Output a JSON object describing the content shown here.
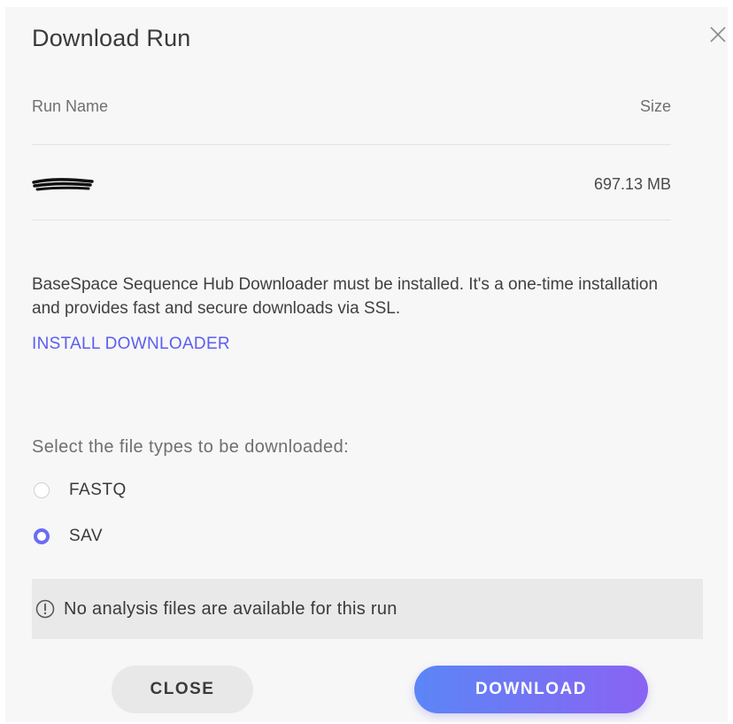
{
  "dialog": {
    "title": "Download Run",
    "close_icon": "close-icon"
  },
  "table": {
    "headers": {
      "name": "Run Name",
      "size": "Size"
    },
    "rows": [
      {
        "name_redacted": true,
        "size": "697.13 MB"
      }
    ]
  },
  "info": {
    "text": "BaseSpace Sequence Hub Downloader must be installed. It's a one-time installation and provides fast and secure downloads via SSL.",
    "install_link": "INSTALL DOWNLOADER"
  },
  "file_types": {
    "label": "Select the file types to be downloaded:",
    "options": [
      {
        "label": "FASTQ",
        "selected": false
      },
      {
        "label": "SAV",
        "selected": true
      }
    ]
  },
  "notice": {
    "icon": "info-circle-icon",
    "text": "No analysis files are available for this run"
  },
  "buttons": {
    "close": "CLOSE",
    "download": "DOWNLOAD"
  },
  "colors": {
    "accent": "#6b6df2",
    "link": "#5b5ef0",
    "download_gradient_start": "#5b86f6",
    "download_gradient_end": "#8a63f3"
  }
}
